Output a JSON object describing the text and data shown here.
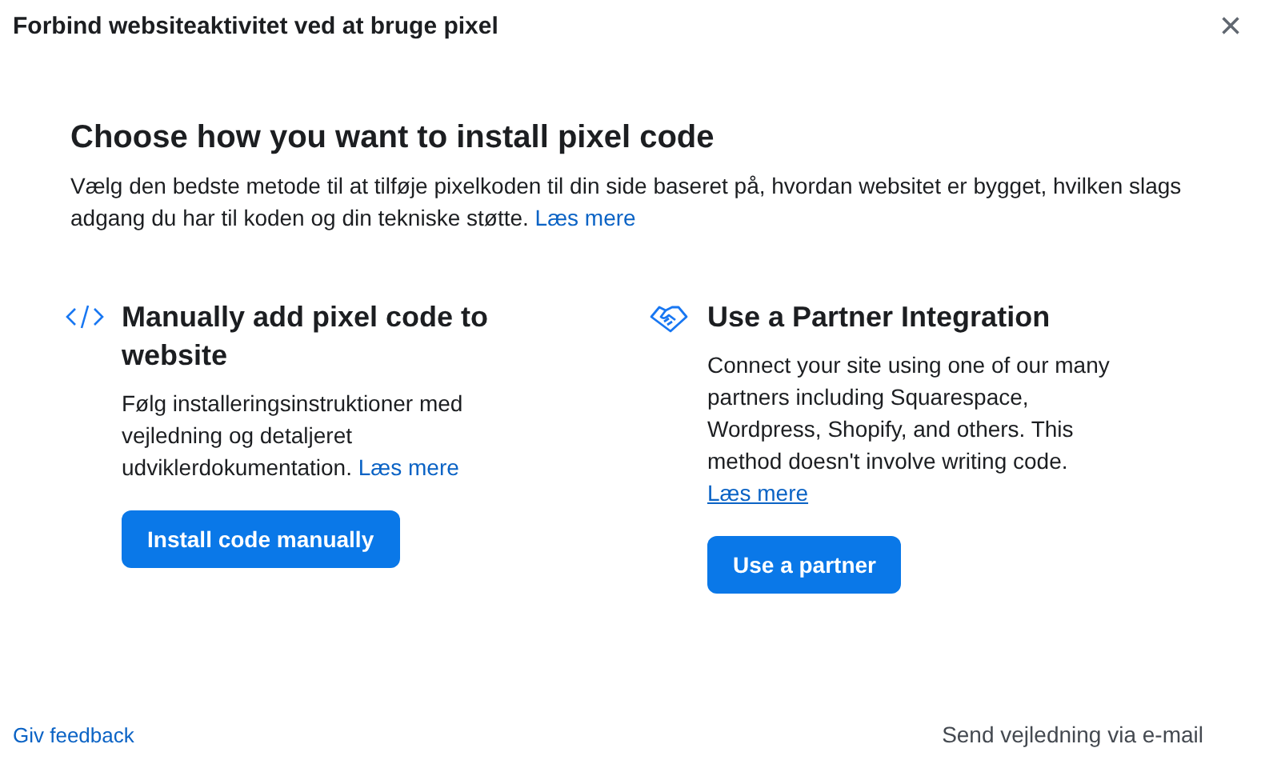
{
  "dialog": {
    "title": "Forbind websiteaktivitet ved at bruge pixel",
    "close": "×"
  },
  "heading": "Choose how you want to install pixel code",
  "intro": {
    "text": "Vælg den bedste metode til at tilføje pixelkoden til din side baseret på, hvordan websitet er bygget, hvilken slags adgang du har til koden og din tekniske støtte.",
    "link": "Læs mere"
  },
  "options": [
    {
      "kind": "code",
      "title": "Manually add pixel code to website",
      "text": "Følg installeringsinstruktioner med vejledning og detaljeret udviklerdokumentation.",
      "link": "Læs mere",
      "link_underlined": false,
      "button": "Install code manually"
    },
    {
      "kind": "partner",
      "title": "Use a Partner Integration",
      "text": "Connect your site using one of our many partners including Squarespace, Wordpress, Shopify, and others. This method doesn't involve writing code.",
      "link": "Læs mere",
      "link_underlined": true,
      "button": "Use a partner"
    }
  ],
  "footer": {
    "feedback_link": "Giv feedback",
    "email_link": "Send vejledning via e-mail"
  }
}
